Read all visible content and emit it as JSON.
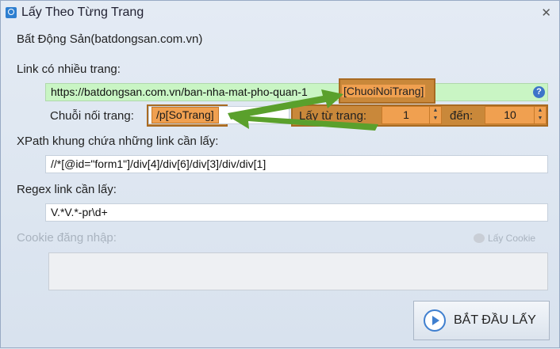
{
  "window": {
    "title": "Lấy Theo Từng Trang",
    "close_glyph": "✕"
  },
  "site_name": "Bất Động Sản(batdongsan.com.vn)",
  "link_section": {
    "label": "Link có nhiều trang:",
    "url_prefix": "https://batdongsan.com.vn/ban-nha-mat-pho-quan-1",
    "placeholder_token": "[ChuoiNoiTrang]",
    "help_glyph": "?"
  },
  "page_string": {
    "label": "Chuỗi nối trang:",
    "value": "/p[SoTrang]"
  },
  "page_range": {
    "from_label": "Lấy từ trang:",
    "from_value": "1",
    "to_label": "đến:",
    "to_value": "10"
  },
  "xpath": {
    "label": "XPath khung chứa những link cần lấy:",
    "value": "//*[@id=\"form1\"]/div[4]/div[6]/div[3]/div/div[1]"
  },
  "regex": {
    "label": "Regex link cần lấy:",
    "value": "V.*V.*-pr\\d+"
  },
  "cookie": {
    "label": "Cookie đăng nhập:",
    "button_label": "Lấy Cookie",
    "value": ""
  },
  "start_button": {
    "label": "BẮT ĐẦU LẤY"
  },
  "icons": {
    "app": "search-window-icon",
    "help": "help-icon",
    "play": "play-icon",
    "cookie": "cookie-icon"
  },
  "colors": {
    "green_field": "#c9f5c4",
    "orange_field": "#f0a050",
    "arrow": "#5aa02c"
  }
}
